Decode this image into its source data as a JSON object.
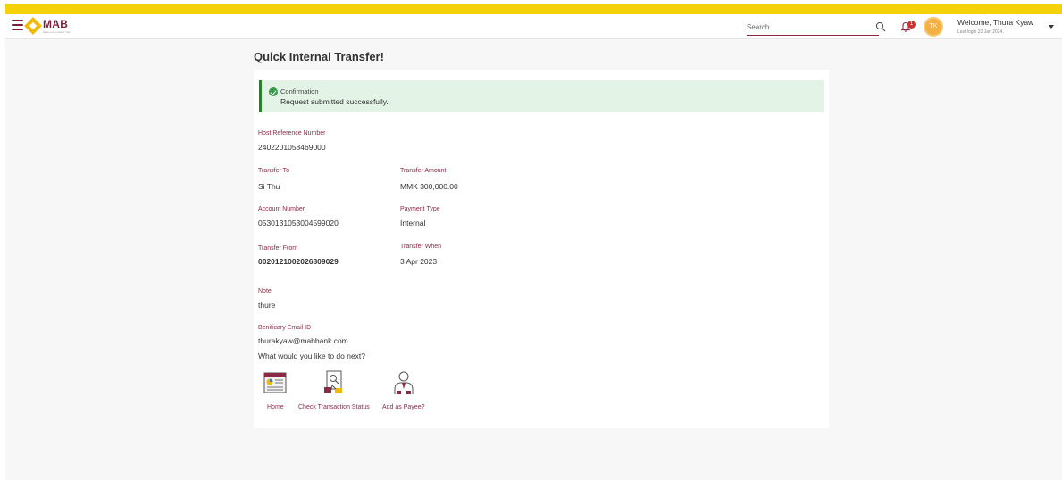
{
  "header": {
    "logo_text": "MAB",
    "logo_tagline": "Make every action Your",
    "search_placeholder": "Search ...",
    "notification_count": "1",
    "avatar_initials": "TK",
    "welcome": "Welcome, Thura Kyaw",
    "last_login": "Last login 22 Jan 2024,"
  },
  "page": {
    "title": "Quick Internal Transfer!"
  },
  "confirmation": {
    "title": "Confirmation",
    "message": "Request submitted successfully."
  },
  "details": {
    "host_ref_label": "Host Reference Number",
    "host_ref_value": "2402201058469000",
    "transfer_to_label": "Transfer To",
    "transfer_to_value": "Si Thu",
    "transfer_amount_label": "Transfer Amount",
    "transfer_amount_value": "MMK 300,000.00",
    "account_number_label": "Account Number",
    "account_number_value": "0530131053004599020",
    "payment_type_label": "Payment Type",
    "payment_type_value": "Internal",
    "transfer_from_label": "Transfer From",
    "transfer_from_value": "0020121002026809029",
    "transfer_when_label": "Transfer When",
    "transfer_when_value": "3 Apr 2023",
    "note_label": "Note",
    "note_value": "thure",
    "email_label": "Benificary Email ID",
    "email_value": "thurakyaw@mabbank.com"
  },
  "next_steps": {
    "question": "What would you like to do next?",
    "actions": [
      {
        "label": "Home",
        "icon": "home-dashboard-icon"
      },
      {
        "label": "Check Transaction Status",
        "icon": "transaction-status-icon"
      },
      {
        "label": "Add as Payee?",
        "icon": "add-payee-icon"
      }
    ]
  },
  "colors": {
    "top_bar": "#f5d10a",
    "brand": "#8a2a45",
    "success_bg": "#e3f3e5",
    "success_border": "#2e7d32"
  }
}
